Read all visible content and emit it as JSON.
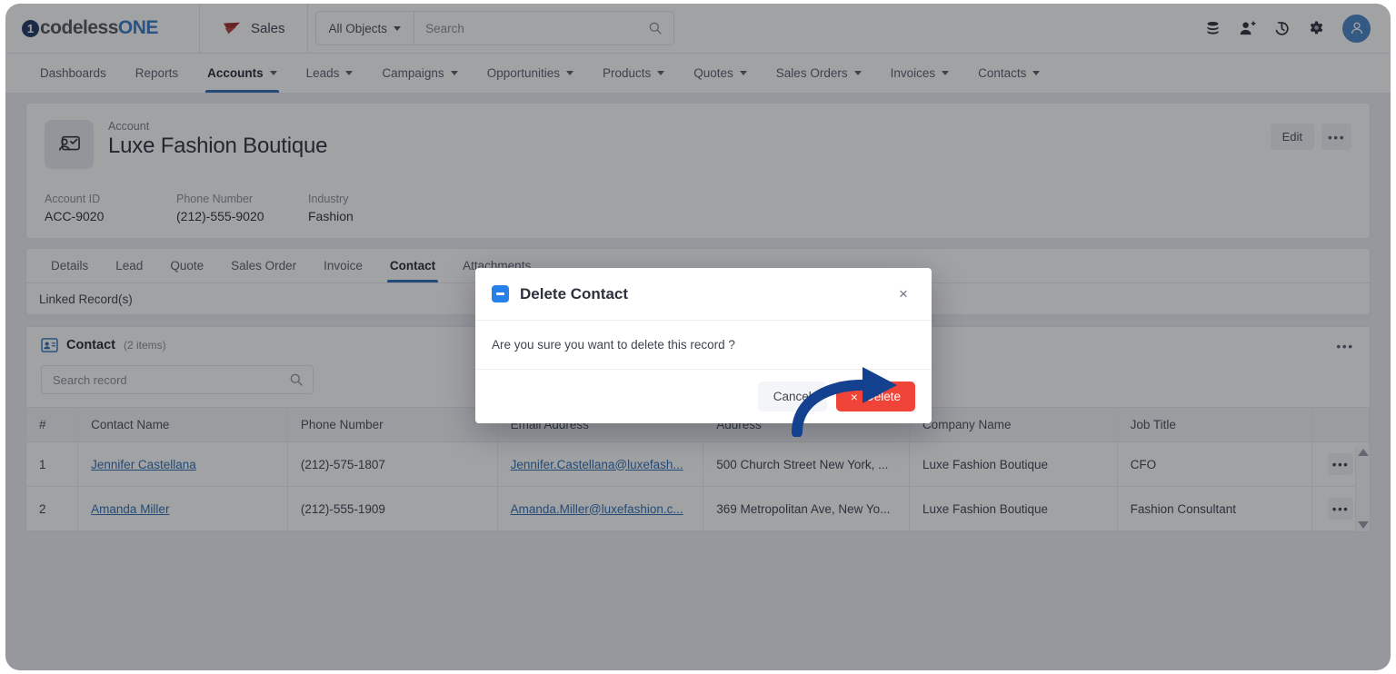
{
  "topbar": {
    "logo_one": "1",
    "logo_codeless": "codeless",
    "logo_one_word": "ONE",
    "app_name": "Sales",
    "object_filter": "All Objects",
    "search_placeholder": "Search",
    "search_value": "",
    "icons": [
      "database-icon",
      "add-user-icon",
      "history-icon",
      "gear-icon",
      "avatar-icon"
    ]
  },
  "nav": {
    "items": [
      {
        "label": "Dashboards",
        "has_caret": false,
        "active": false
      },
      {
        "label": "Reports",
        "has_caret": false,
        "active": false
      },
      {
        "label": "Accounts",
        "has_caret": true,
        "active": true
      },
      {
        "label": "Leads",
        "has_caret": true,
        "active": false
      },
      {
        "label": "Campaigns",
        "has_caret": true,
        "active": false
      },
      {
        "label": "Opportunities",
        "has_caret": true,
        "active": false
      },
      {
        "label": "Products",
        "has_caret": true,
        "active": false
      },
      {
        "label": "Quotes",
        "has_caret": true,
        "active": false
      },
      {
        "label": "Sales Orders",
        "has_caret": true,
        "active": false
      },
      {
        "label": "Invoices",
        "has_caret": true,
        "active": false
      },
      {
        "label": "Contacts",
        "has_caret": true,
        "active": false
      }
    ]
  },
  "record": {
    "kind": "Account",
    "title": "Luxe Fashion Boutique",
    "edit_label": "Edit",
    "more_label": "•••",
    "fields": [
      {
        "label": "Account ID",
        "value": "ACC-9020"
      },
      {
        "label": "Phone Number",
        "value": "(212)-555-9020"
      },
      {
        "label": "Industry",
        "value": "Fashion"
      }
    ]
  },
  "subtabs": {
    "items": [
      {
        "label": "Details",
        "active": false
      },
      {
        "label": "Lead",
        "active": false
      },
      {
        "label": "Quote",
        "active": false
      },
      {
        "label": "Sales Order",
        "active": false
      },
      {
        "label": "Invoice",
        "active": false
      },
      {
        "label": "Contact",
        "active": true
      },
      {
        "label": "Attachments",
        "active": false
      }
    ],
    "linked_records_label": "Linked Record(s)"
  },
  "list": {
    "title": "Contact",
    "count_label": "(2 items)",
    "more_label": "•••",
    "search_placeholder": "Search record",
    "search_value": "",
    "columns": [
      "#",
      "Contact Name",
      "Phone Number",
      "Email Address",
      "Address",
      "Company Name",
      "Job Title",
      ""
    ],
    "rows": [
      {
        "index": "1",
        "name": "Jennifer Castellana",
        "phone": "(212)-575-1807",
        "email": "Jennifer.Castellana@luxefash...",
        "address": "500 Church Street New York, ...",
        "company": "Luxe Fashion Boutique",
        "job": "CFO",
        "more": "•••"
      },
      {
        "index": "2",
        "name": "Amanda Miller",
        "phone": "(212)-555-1909",
        "email": "Amanda.Miller@luxefashion.c...",
        "address": "369 Metropolitan Ave, New Yo...",
        "company": "Luxe Fashion Boutique",
        "job": "Fashion Consultant",
        "more": "•••"
      }
    ]
  },
  "modal": {
    "title": "Delete Contact",
    "close_label": "×",
    "message": "Are you sure you want to delete this record ?",
    "cancel_label": "Cancel",
    "delete_label": "Delete",
    "delete_icon": "×"
  },
  "colors": {
    "accent_blue": "#2f6fb5",
    "modal_icon_blue": "#2680ea",
    "danger_red": "#f04438",
    "annotation_navy": "#14418f",
    "sales_red": "#9e2a2b",
    "page_bg": "#edeff3"
  }
}
